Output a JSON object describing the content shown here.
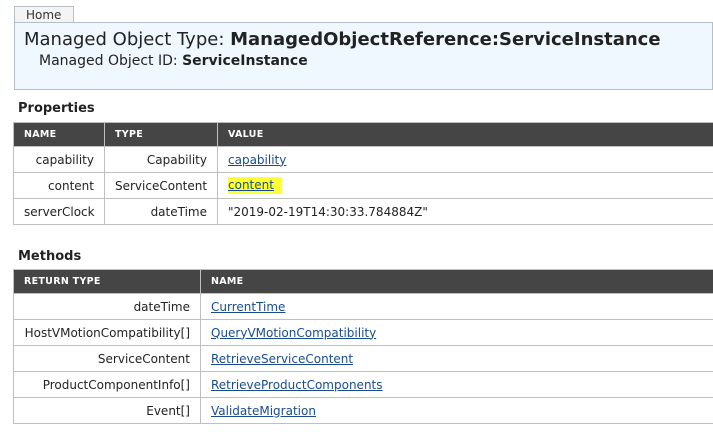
{
  "nav": {
    "home_label": "Home"
  },
  "header": {
    "type_prefix": "Managed Object Type: ",
    "type_value": "ManagedObjectReference:ServiceInstance",
    "id_prefix": "Managed Object ID: ",
    "id_value": "ServiceInstance"
  },
  "properties": {
    "title": "Properties",
    "columns": [
      "NAME",
      "TYPE",
      "VALUE"
    ],
    "rows": [
      {
        "name": "capability",
        "type": "Capability",
        "value": "capability"
      },
      {
        "name": "content",
        "type": "ServiceContent",
        "value": "content"
      },
      {
        "name": "serverClock",
        "type": "dateTime",
        "value": "\"2019-02-19T14:30:33.784884Z\""
      }
    ]
  },
  "methods": {
    "title": "Methods",
    "columns": [
      "RETURN TYPE",
      "NAME"
    ],
    "rows": [
      {
        "return_type": "dateTime",
        "name": "CurrentTime"
      },
      {
        "return_type": "HostVMotionCompatibility[]",
        "name": "QueryVMotionCompatibility"
      },
      {
        "return_type": "ServiceContent",
        "name": "RetrieveServiceContent"
      },
      {
        "return_type": "ProductComponentInfo[]",
        "name": "RetrieveProductComponents"
      },
      {
        "return_type": "Event[]",
        "name": "ValidateMigration"
      }
    ]
  },
  "colors": {
    "header_bg": "#f0f8ff",
    "table_header_bg": "#454545",
    "link": "#1a4c8a",
    "highlight": "#ffff33"
  }
}
